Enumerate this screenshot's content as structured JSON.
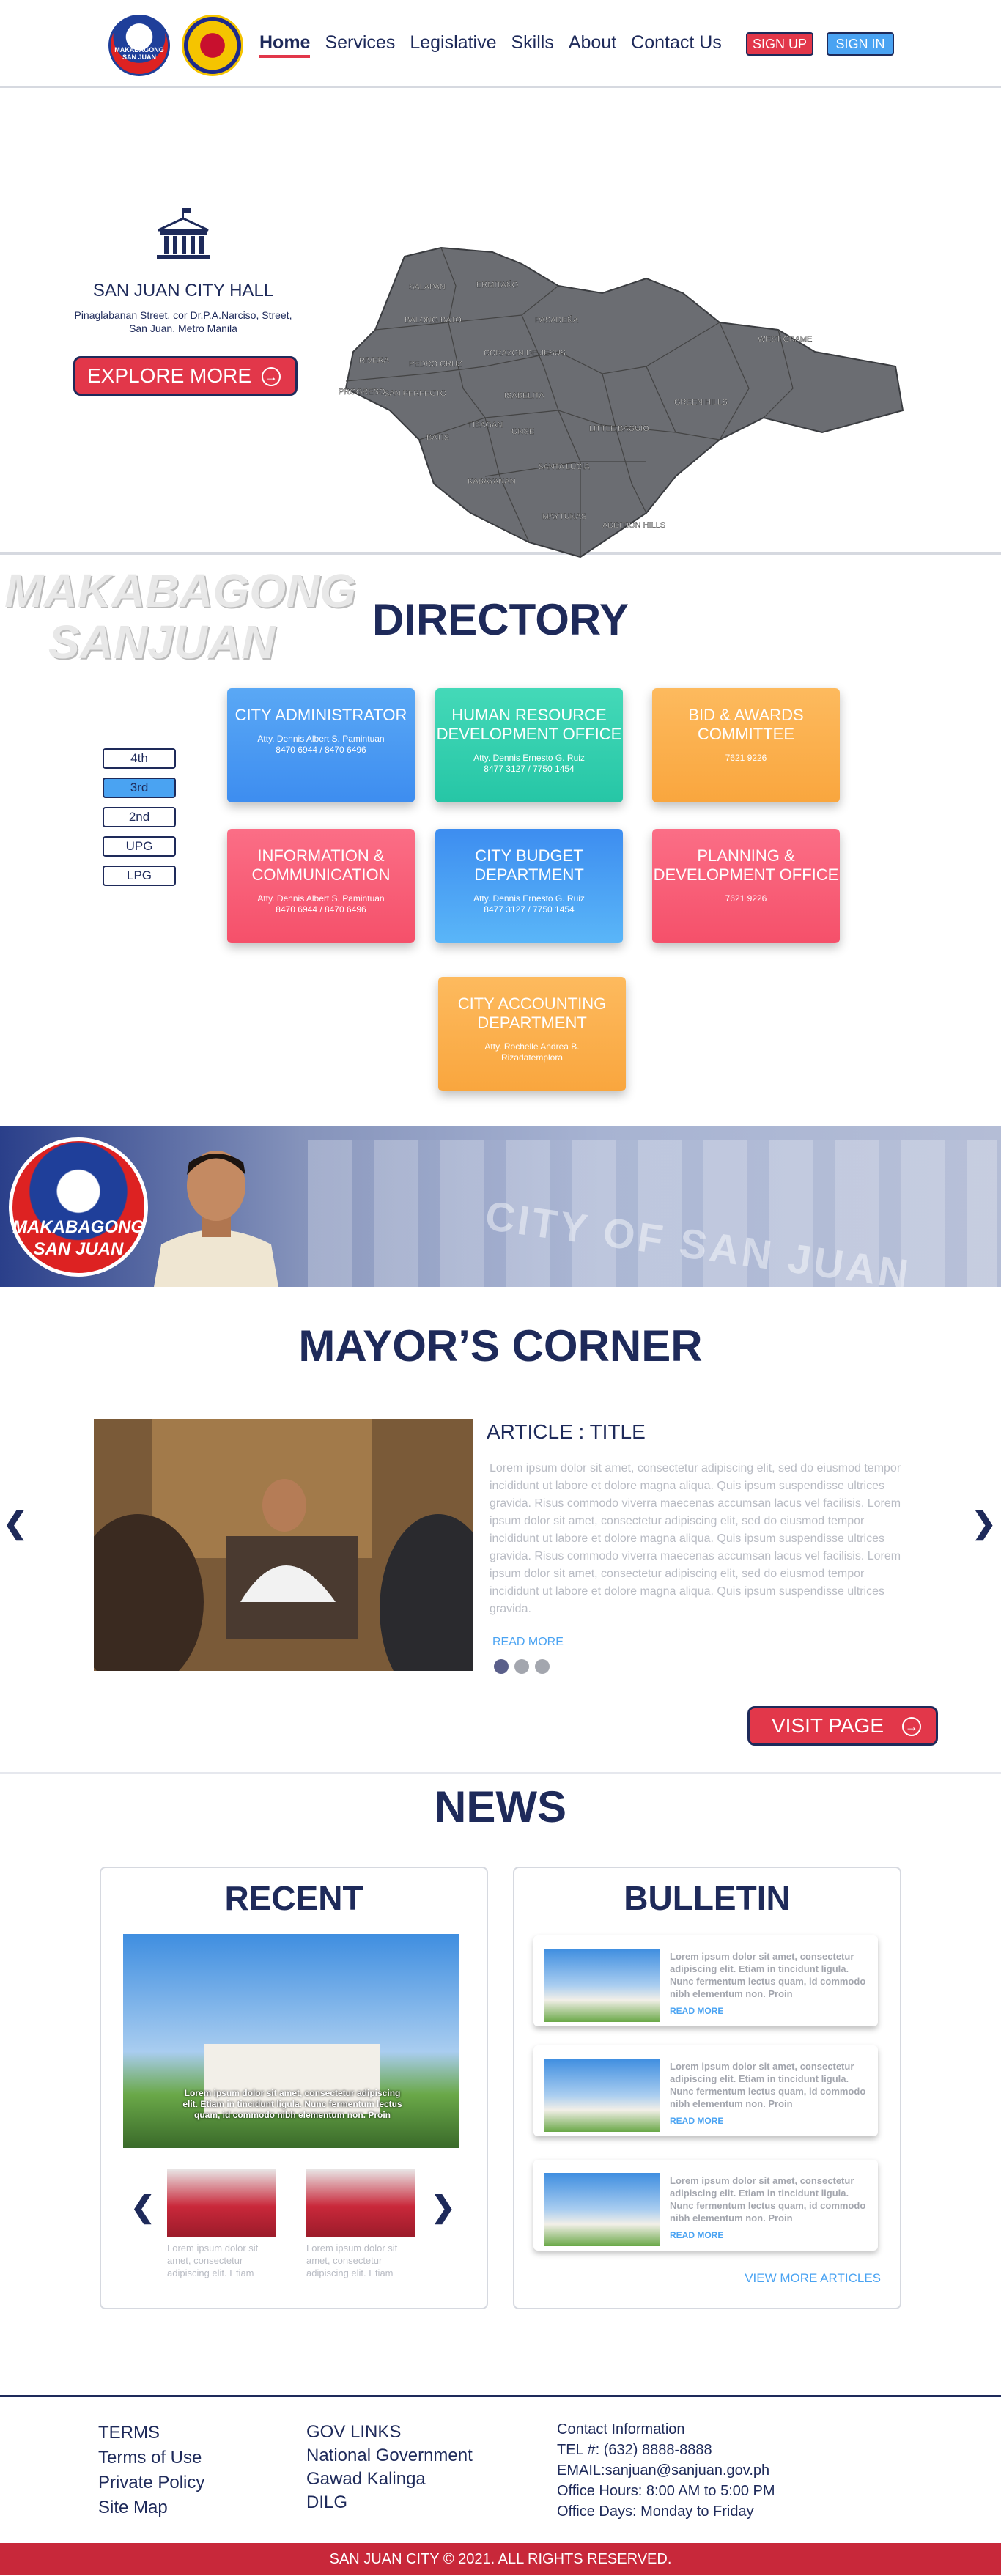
{
  "nav": {
    "logo1_text": "MAKABAGONG SAN JUAN",
    "items": [
      "Home",
      "Services",
      "Legislative",
      "Skills",
      "About",
      "Contact Us"
    ],
    "signup": "SIGN UP",
    "signin": "SIGN IN"
  },
  "hero": {
    "title": "SAN JUAN CITY HALL",
    "address_line1": "Pinaglabanan Street, cor Dr.P.A.Narciso, Street,",
    "address_line2": "San Juan, Metro Manila",
    "explore": "EXPLORE MORE",
    "barangays": [
      "SALAPAN",
      "ERMITAÑO",
      "BALONG BATO",
      "PASADEÑA",
      "CORAZON DE JESUS",
      "RIVERA",
      "PEDRO CRUZ",
      "PROGRESO",
      "SAN PERFECTO",
      "BATIS",
      "TIBAGAN",
      "ISABELITA",
      "ONSE",
      "KABAYANAN",
      "LITTLE BAGUIO",
      "SANTA LUCIA",
      "MAYTUNAS",
      "ADDITION HILLS",
      "WEST CRAME",
      "GREEN HILLS"
    ]
  },
  "directory": {
    "watermark1": "MAKABAGONG",
    "watermark2": "SANJUAN",
    "title": "DIRECTORY",
    "floors": [
      "4th",
      "3rd",
      "2nd",
      "UPG",
      "LPG"
    ],
    "cards": [
      {
        "title": "CITY ADMINISTRATOR",
        "line1": "Atty. Dennis Albert S. Pamintuan",
        "line2": "8470 6944 / 8470 6496"
      },
      {
        "title": "HUMAN RESOURCE DEVELOPMENT OFFICE",
        "line1": "Atty. Dennis Ernesto G. Ruiz",
        "line2": "8477 3127 / 7750 1454"
      },
      {
        "title": "BID & AWARDS COMMITTEE",
        "line1": "",
        "line2": "7621 9226"
      },
      {
        "title": "INFORMATION & COMMUNICATION",
        "line1": "Atty. Dennis Albert S. Pamintuan",
        "line2": "8470 6944 / 8470 6496"
      },
      {
        "title": "CITY BUDGET DEPARTMENT",
        "line1": "Atty. Dennis Ernesto G. Ruiz",
        "line2": "8477 3127 / 7750 1454"
      },
      {
        "title": "PLANNING & DEVELOPMENT OFFICE",
        "line1": "",
        "line2": "7621 9226"
      },
      {
        "title": "CITY ACCOUNTING DEPARTMENT",
        "line1": "Atty. Rochelle Andrea B.",
        "line2": "Rizadatemplora"
      }
    ]
  },
  "banner": {
    "seal_line1": "MAKABAGONG",
    "seal_line2": "SAN JUAN",
    "building_text": "CITY OF SAN JUAN"
  },
  "mayor": {
    "title": "MAYOR’S CORNER",
    "article_title": "ARTICLE : TITLE",
    "body": "Lorem ipsum dolor sit amet, consectetur adipiscing elit, sed do eiusmod tempor incididunt ut labore et dolore magna aliqua. Quis ipsum suspendisse ultrices gravida. Risus commodo viverra maecenas accumsan lacus vel facilisis. Lorem ipsum dolor sit amet, consectetur adipiscing elit, sed do eiusmod tempor incididunt ut labore et dolore magna aliqua. Quis ipsum suspendisse ultrices gravida. Risus commodo viverra maecenas accumsan lacus vel facilisis. Lorem ipsum dolor sit amet, consectetur adipiscing elit, sed do eiusmod tempor incididunt ut labore et dolore magna aliqua. Quis ipsum suspendisse ultrices gravida.",
    "read_more": "READ MORE",
    "prev": "❮",
    "next": "❯",
    "visit": "VISIT PAGE"
  },
  "news": {
    "title": "NEWS",
    "recent_title": "RECENT",
    "recent_caption": "Lorem ipsum dolor sit amet, consectetur adipiscing elit. Etiam in tincidunt ligula. Nunc fermentum lectus quam, id commodo nibh elementum non. Proin",
    "thumb_caption": "Lorem ipsum dolor sit amet, consectetur adipiscing elit. Etiam",
    "bulletin_title": "BULLETIN",
    "bulletin_text": "Lorem ipsum dolor sit amet, consectetur adipiscing elit. Etiam in tincidunt ligula. Nunc fermentum lectus quam, id commodo nibh elementum non. Proin",
    "bulletin_read": "READ MORE",
    "view_more": "VIEW MORE ARTICLES",
    "prev": "❮",
    "next": "❯"
  },
  "footer": {
    "col1": [
      "TERMS",
      "Terms of Use",
      "Private Policy",
      "Site Map"
    ],
    "col2": [
      "GOV LINKS",
      "National Government",
      "Gawad Kalinga",
      "DILG"
    ],
    "col3": [
      "Contact Information",
      "TEL #:  (632) 8888-8888",
      "EMAIL:sanjuan@sanjuan.gov.ph",
      "Office Hours: 8:00 AM to 5:00 PM",
      "Office Days: Monday to Friday"
    ],
    "copyright": "SAN JUAN CITY © 2021. ALL RIGHTS RESERVED."
  },
  "colors": {
    "navy": "#1e2a5a",
    "red": "#e2374a",
    "blue": "#4aa3f2",
    "green": "#3ed2b0",
    "orange": "#fbb252",
    "pink": "#f8617a"
  }
}
